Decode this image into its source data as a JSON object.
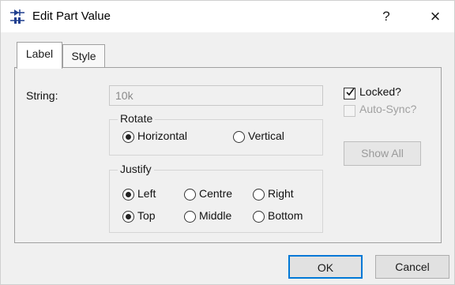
{
  "window": {
    "title": "Edit Part Value",
    "help_label": "?",
    "close_label": "×"
  },
  "tabs": [
    {
      "label": "Label",
      "selected": true
    },
    {
      "label": "Style",
      "selected": false
    }
  ],
  "string_field": {
    "label": "String:",
    "value": "10k",
    "enabled": false
  },
  "rotate": {
    "title": "Rotate",
    "options": [
      {
        "label": "Horizontal",
        "checked": true
      },
      {
        "label": "Vertical",
        "checked": false
      }
    ]
  },
  "justify": {
    "title": "Justify",
    "horizontal_options": [
      {
        "label": "Left",
        "checked": true
      },
      {
        "label": "Centre",
        "checked": false
      },
      {
        "label": "Right",
        "checked": false
      }
    ],
    "vertical_options": [
      {
        "label": "Top",
        "checked": true
      },
      {
        "label": "Middle",
        "checked": false
      },
      {
        "label": "Bottom",
        "checked": false
      }
    ]
  },
  "locked": {
    "label": "Locked?",
    "checked": true,
    "enabled": true
  },
  "auto_sync": {
    "label": "Auto-Sync?",
    "checked": false,
    "enabled": false
  },
  "show_all_label": "Show All",
  "ok_label": "OK",
  "cancel_label": "Cancel",
  "colors": {
    "accent": "#0078d7",
    "dialog_bg": "#f0f0f0",
    "disabled_text": "#a0a0a0"
  }
}
